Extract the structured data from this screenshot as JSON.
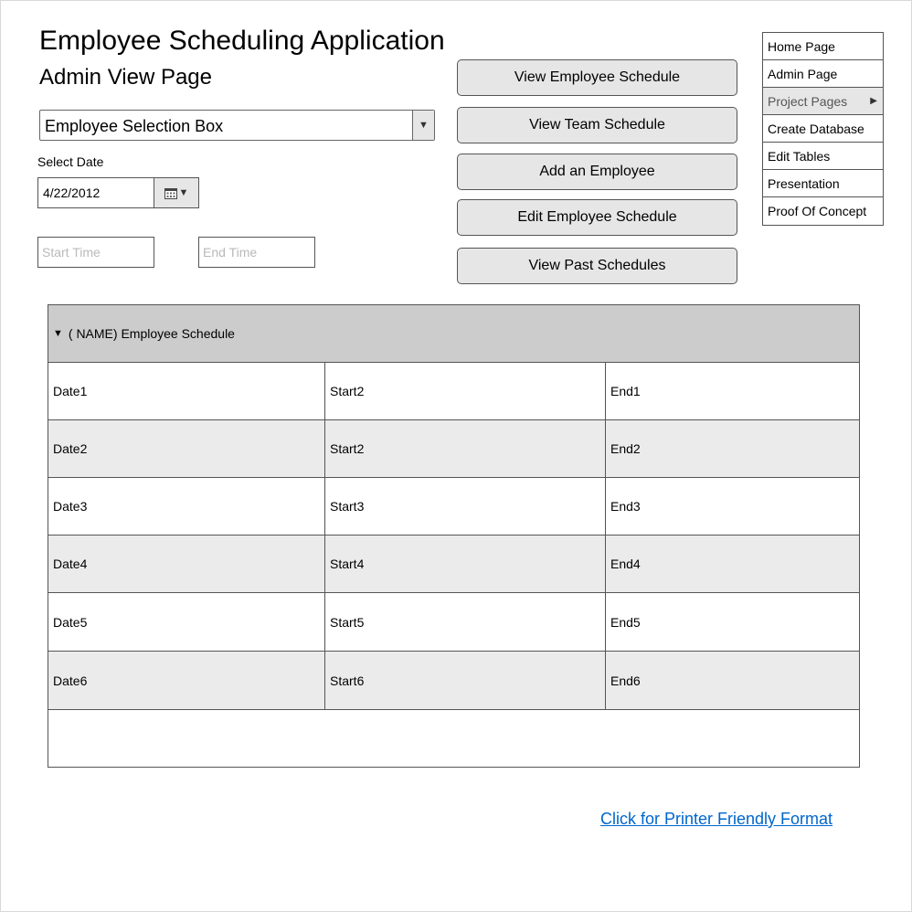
{
  "app": {
    "title": "Employee Scheduling Application",
    "subtitle": "Admin View Page"
  },
  "employee_select": {
    "value": "Employee Selection Box"
  },
  "date_picker": {
    "label": "Select Date",
    "value": "4/22/2012"
  },
  "time_fields": {
    "start_placeholder": "Start Time",
    "end_placeholder": "End Time"
  },
  "actions": [
    {
      "label": "View Employee Schedule"
    },
    {
      "label": "View Team Schedule"
    },
    {
      "label": "Add an Employee"
    },
    {
      "label": "Edit Employee Schedule"
    },
    {
      "label": "View Past Schedules"
    }
  ],
  "nav": {
    "items": [
      {
        "label": "Home Page"
      },
      {
        "label": "Admin Page"
      },
      {
        "label": "Project Pages",
        "active": true,
        "has_submenu": true
      },
      {
        "label": "Create Database"
      },
      {
        "label": "Edit Tables"
      },
      {
        "label": "Presentation"
      },
      {
        "label": "Proof Of Concept"
      }
    ]
  },
  "schedule": {
    "header": "( NAME) Employee Schedule",
    "rows": [
      [
        "Date1",
        "Start2",
        "End1"
      ],
      [
        "Date2",
        "Start2",
        "End2"
      ],
      [
        "Date3",
        "Start3",
        "End3"
      ],
      [
        "Date4",
        "Start4",
        "End4"
      ],
      [
        "Date5",
        "Start5",
        "End5"
      ],
      [
        "Date6",
        "Start6",
        "End6"
      ]
    ]
  },
  "footer": {
    "print_link": "Click for Printer Friendly Format"
  },
  "colors": {
    "button_bg": "#e6e6e6",
    "table_header_bg": "#cccccc",
    "alt_row_bg": "#ebebeb",
    "link": "#0066cc"
  }
}
